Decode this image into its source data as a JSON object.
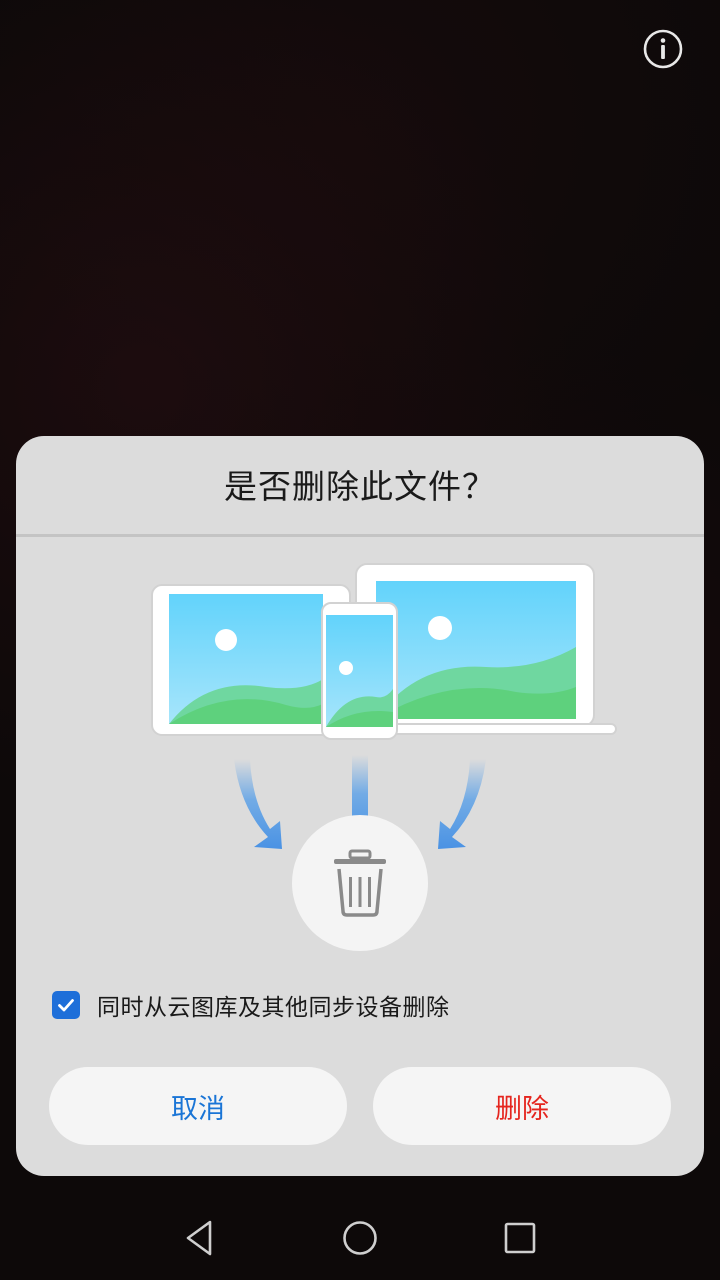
{
  "top_bar": {
    "info_icon": "info-circle-icon"
  },
  "dialog": {
    "title": "是否删除此文件？",
    "illustration_icons": [
      "laptop-icon",
      "tablet-icon",
      "phone-icon",
      "trash-icon"
    ],
    "option": {
      "label": "同时从云图库及其他同步设备删除",
      "checked": true
    },
    "buttons": {
      "cancel": "取消",
      "delete": "删除"
    },
    "colors": {
      "accent": "#1a75d6",
      "danger": "#e5251e"
    }
  },
  "navbar": {
    "icons": [
      "back-icon",
      "home-icon",
      "recents-icon"
    ]
  }
}
